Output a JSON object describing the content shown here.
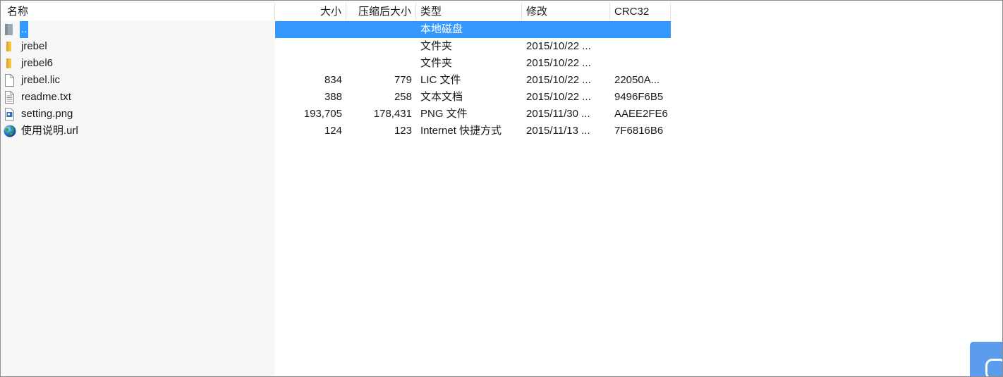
{
  "columns": {
    "name": "名称",
    "size": "大小",
    "packed": "压缩后大小",
    "type": "类型",
    "modified": "修改",
    "crc": "CRC32",
    "sort_indicator": "^"
  },
  "colors": {
    "selection": "#3399ff",
    "folder": "#f5c342",
    "name_column_bg": "#f7f7f7",
    "widget": "#5c9cec"
  },
  "rows": [
    {
      "icon": "parent-dir-icon",
      "name": "..",
      "size": "",
      "packed": "",
      "type": "本地磁盘",
      "modified": "",
      "crc": "",
      "selected": true
    },
    {
      "icon": "folder-icon",
      "name": "jrebel",
      "size": "",
      "packed": "",
      "type": "文件夹",
      "modified": "2015/10/22 ...",
      "crc": ""
    },
    {
      "icon": "folder-icon",
      "name": "jrebel6",
      "size": "",
      "packed": "",
      "type": "文件夹",
      "modified": "2015/10/22 ...",
      "crc": ""
    },
    {
      "icon": "file-icon",
      "name": "jrebel.lic",
      "size": "834",
      "packed": "779",
      "type": "LIC 文件",
      "modified": "2015/10/22 ...",
      "crc": "22050A..."
    },
    {
      "icon": "text-file-icon",
      "name": "readme.txt",
      "size": "388",
      "packed": "258",
      "type": "文本文档",
      "modified": "2015/10/22 ...",
      "crc": "9496F6B5"
    },
    {
      "icon": "image-file-icon",
      "name": "setting.png",
      "size": "193,705",
      "packed": "178,431",
      "type": "PNG 文件",
      "modified": "2015/11/30 ...",
      "crc": "AAEE2FE6"
    },
    {
      "icon": "globe-icon",
      "name": "使用说明.url",
      "size": "124",
      "packed": "123",
      "type": "Internet 快捷方式",
      "modified": "2015/11/13 ...",
      "crc": "7F6816B6"
    }
  ]
}
